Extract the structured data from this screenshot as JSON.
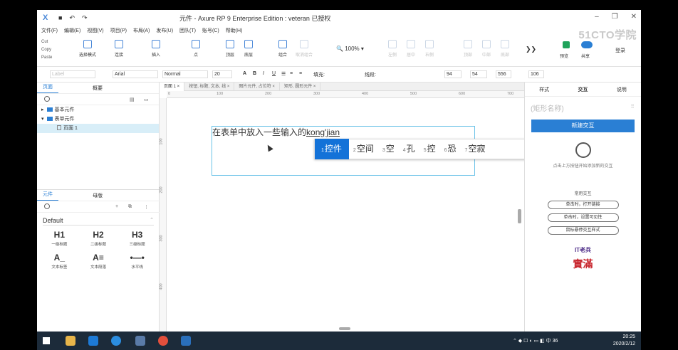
{
  "window": {
    "title": "元件 - Axure RP 9 Enterprise Edition : veteran 已授权"
  },
  "watermark": "51CTO学院",
  "menu": [
    "文件(F)",
    "编辑(E)",
    "视图(V)",
    "项目(P)",
    "布局(A)",
    "发布(U)",
    "团队(T)",
    "账号(C)",
    "帮助(H)"
  ],
  "clipboard": [
    "Cut",
    "Copy",
    "Paste"
  ],
  "toolbar": {
    "tools": [
      {
        "label": "选择模式",
        "dim": false
      },
      {
        "label": "连接",
        "dim": false
      },
      {
        "label": "插入",
        "dim": false
      },
      {
        "label": "点",
        "dim": false
      },
      {
        "label": "顶层",
        "dim": false
      },
      {
        "label": "底层",
        "dim": false
      },
      {
        "label": "组合",
        "dim": false
      },
      {
        "label": "取消组合",
        "dim": true
      },
      {
        "label": "左侧",
        "dim": true
      },
      {
        "label": "居中",
        "dim": true
      },
      {
        "label": "右侧",
        "dim": true
      },
      {
        "label": "顶部",
        "dim": true
      },
      {
        "label": "中部",
        "dim": true
      },
      {
        "label": "底部",
        "dim": true
      }
    ],
    "zoom": "100%",
    "preview": "预览",
    "share": "共享",
    "login": "登录"
  },
  "format": {
    "style": "Label",
    "font": "Arial",
    "weight": "Normal",
    "size": "20",
    "fill_label": "填充:",
    "line_label": "线段:",
    "x": "94",
    "y": "54",
    "w": "556",
    "h": "106"
  },
  "pages_panel": {
    "tabs": [
      "页面",
      "概要"
    ],
    "items": [
      {
        "label": "基本元件",
        "type": "folder"
      },
      {
        "label": "表单元件",
        "type": "folder"
      },
      {
        "label": "页面 1",
        "type": "page",
        "selected": true
      }
    ]
  },
  "library_panel": {
    "tabs": [
      "元件",
      "母版"
    ],
    "selected_library": "Default",
    "widgets": [
      {
        "icon": "H1",
        "label": "一级标题"
      },
      {
        "icon": "H2",
        "label": "二级标题"
      },
      {
        "icon": "H3",
        "label": "三级标题"
      },
      {
        "icon": "A_",
        "label": "文本标签"
      },
      {
        "icon": "A≡",
        "label": "文本段落"
      },
      {
        "icon": "•—•",
        "label": "水平线"
      }
    ]
  },
  "canvas": {
    "tabs": [
      "页面 1",
      "按钮, 标题, 文本, 线",
      "图片元件, 占位符",
      "矩形, 圆形元件"
    ],
    "ruler_h": [
      "0",
      "100",
      "200",
      "300",
      "400",
      "500",
      "600",
      "700"
    ],
    "ruler_v": [
      "100",
      "200",
      "300",
      "400"
    ],
    "typed_text": "在表单中放入一些输入的",
    "composing_text": "kong'jian"
  },
  "ime": {
    "candidates": [
      {
        "n": "1",
        "text": "控件"
      },
      {
        "n": "2",
        "text": "空间"
      },
      {
        "n": "3",
        "text": "空"
      },
      {
        "n": "4",
        "text": "孔"
      },
      {
        "n": "5",
        "text": "控"
      },
      {
        "n": "6",
        "text": "恐"
      },
      {
        "n": "7",
        "text": "空寂"
      }
    ],
    "emoji": "☺"
  },
  "right_panel": {
    "tabs": [
      "样式",
      "交互",
      "说明"
    ],
    "shape_name_placeholder": "(矩形名称)",
    "new_interaction": "新建交互",
    "hint": "点击上方按钮开始添加新的交互",
    "common_title": "常用交互",
    "common": [
      "单击时，打开链接",
      "单击时，设置可见性",
      "鼠标悬停交互样式"
    ],
    "logo1": "IT老兵",
    "logo2": "實滿"
  },
  "taskbar": {
    "time": "20:25",
    "date": "2020/2/12",
    "ime_mode": "中",
    "badge": "36"
  }
}
